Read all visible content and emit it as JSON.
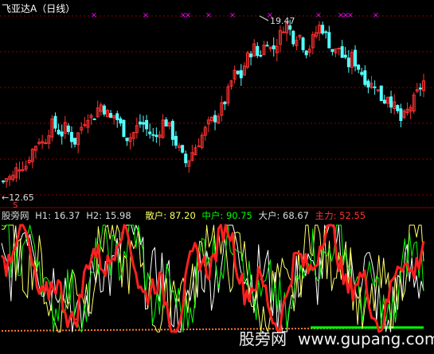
{
  "window_title": "飞亚达A（日线）",
  "upper_chart": {
    "high_label": "19.47",
    "low_label": "←12.65",
    "low_marker": "S",
    "star_glyph": "×"
  },
  "indicator": {
    "name": "股旁网",
    "h1_label": "H1: 16.37",
    "h2_label": "H2: 15.98",
    "retail_label": "散户: 87.20",
    "mid_label": "中户: 90.75",
    "big_label": "大户: 68.67",
    "main_label": "主力: 52.55"
  },
  "watermark": {
    "text": "股旁网",
    "url": "www.gupang.com"
  },
  "colors": {
    "bg": "#000000",
    "up_candle": "#ff3232",
    "down_candle": "#54ffff",
    "grid": "#8a0000",
    "stars": "#ff00ff",
    "retail": "#ffffff",
    "mid": "#00ff00",
    "big": "#ffff00",
    "main": "#ff2020",
    "yellow_line": "#ffff66"
  },
  "chart_data": {
    "type": "candlestick",
    "title": "飞亚达A（日线）",
    "price_high": 19.47,
    "price_low": 12.65,
    "close_path": [
      12.9,
      13.1,
      13.0,
      13.4,
      13.6,
      13.5,
      14.0,
      14.3,
      14.6,
      14.4,
      14.9,
      15.2,
      15.0,
      14.8,
      15.1,
      14.7,
      14.5,
      14.9,
      15.3,
      15.6,
      15.4,
      15.8,
      16.0,
      15.7,
      15.4,
      15.6,
      15.2,
      14.9,
      14.6,
      14.8,
      15.1,
      15.3,
      15.0,
      14.8,
      14.6,
      15.0,
      15.4,
      15.1,
      14.7,
      14.3,
      13.9,
      13.6,
      14.0,
      14.3,
      14.6,
      14.9,
      15.2,
      15.4,
      15.6,
      15.9,
      16.3,
      16.9,
      17.3,
      17.0,
      17.6,
      18.0,
      18.3,
      17.9,
      18.2,
      18.6,
      18.1,
      18.4,
      18.8,
      19.3,
      19.0,
      18.6,
      18.9,
      18.4,
      18.1,
      18.5,
      18.9,
      19.2,
      18.8,
      18.4,
      18.0,
      18.3,
      17.8,
      17.5,
      17.9,
      17.6,
      17.3,
      17.0,
      16.7,
      16.9,
      16.4,
      16.1,
      16.4,
      16.0,
      15.7,
      15.3,
      15.6,
      15.9,
      16.2,
      16.6,
      16.9
    ],
    "series": [
      {
        "name": "散户",
        "last": 87.2
      },
      {
        "name": "中户",
        "last": 90.75
      },
      {
        "name": "大户",
        "last": 68.67
      },
      {
        "name": "主力",
        "last": 52.55
      }
    ],
    "h1": 16.37,
    "h2": 15.98
  }
}
